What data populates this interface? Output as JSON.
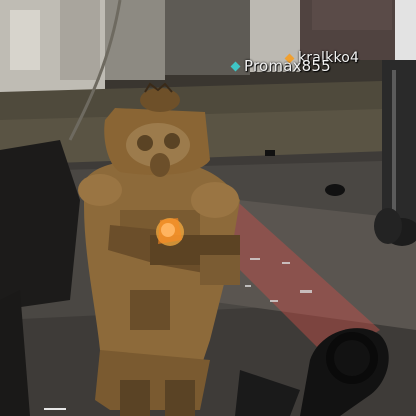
{
  "players": [
    {
      "name": "kralkko4",
      "marker_color": "#f0a030",
      "marker_icon": "diamond-icon"
    },
    {
      "name": "Promax855",
      "marker_color": "#3ec6c6",
      "marker_icon": "diamond-icon"
    }
  ],
  "scene": {
    "character": "gas-mask soldier firing weapon",
    "muzzle_flash_color": "#ffb040",
    "laser_color": "#c8504a"
  }
}
